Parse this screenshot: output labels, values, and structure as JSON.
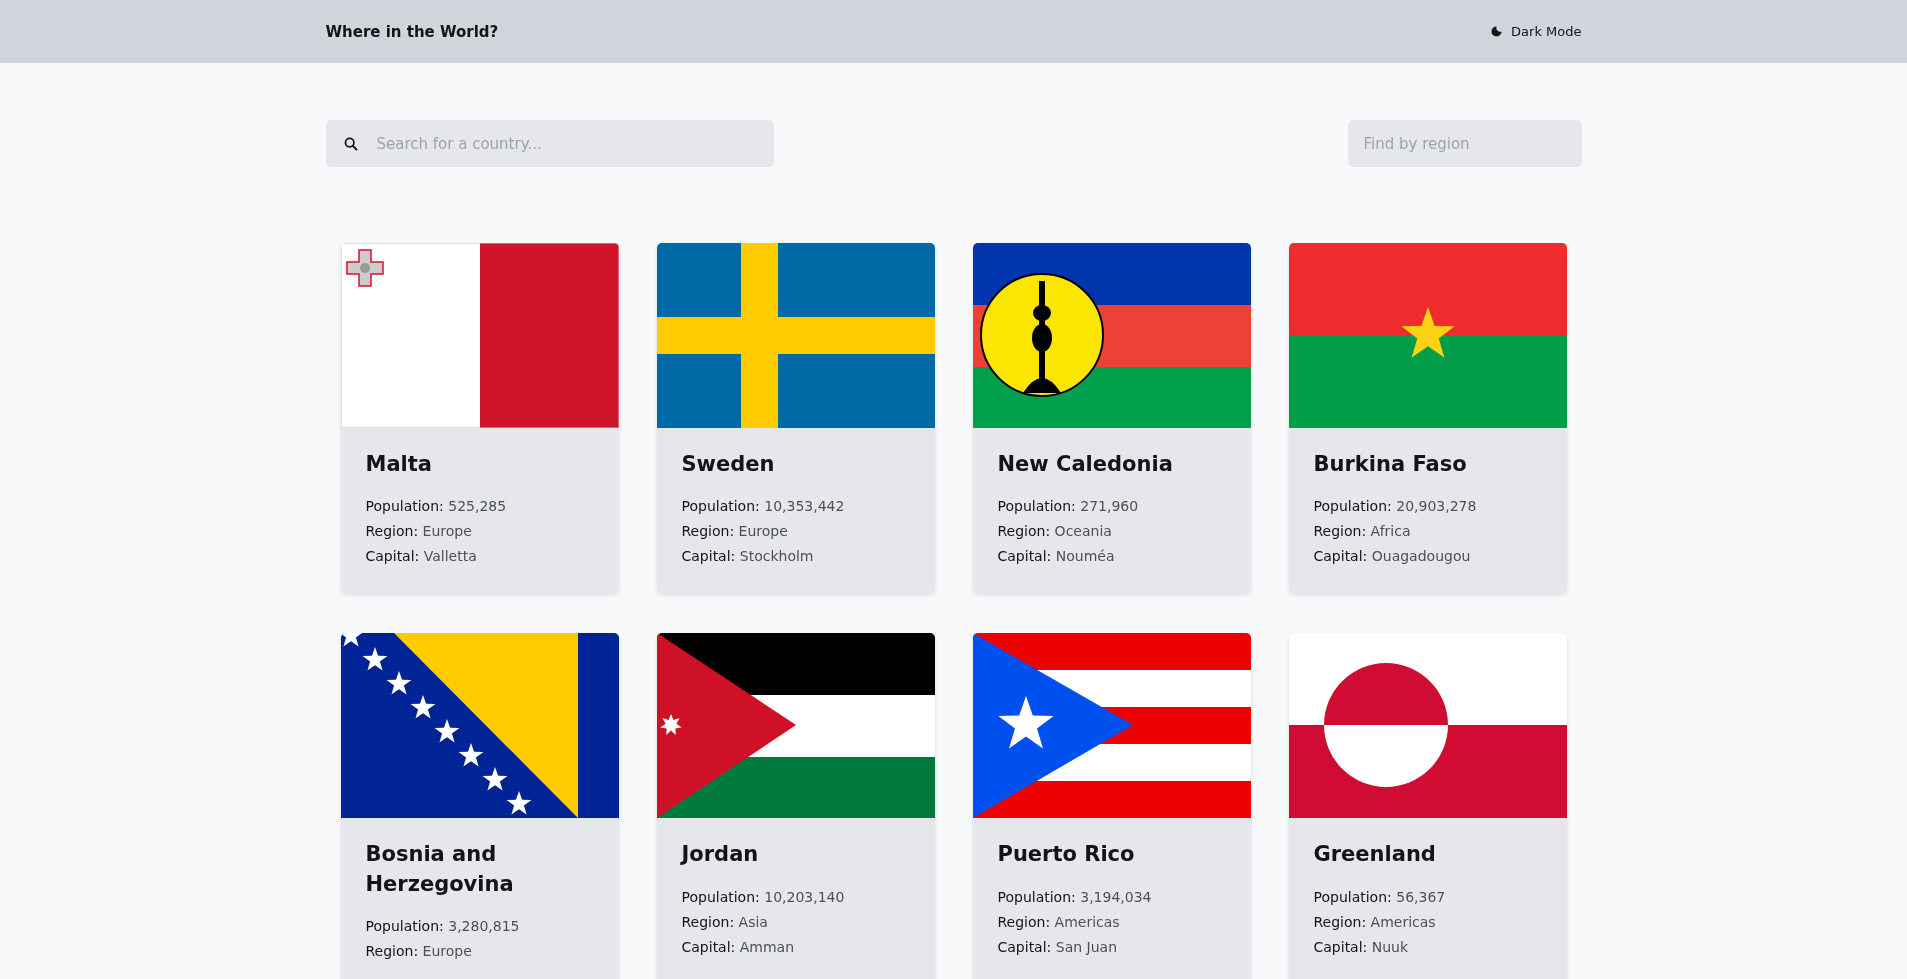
{
  "header": {
    "title": "Where in the World?",
    "theme_toggle": "Dark Mode"
  },
  "search": {
    "placeholder": "Search for a country..."
  },
  "region_filter": {
    "label": "Find by region"
  },
  "countries": [
    {
      "name": "Malta",
      "details": [
        {
          "label": "Population:",
          "value": "525,285"
        },
        {
          "label": "Region:",
          "value": "Europe"
        },
        {
          "label": "Capital:",
          "value": "Valletta"
        }
      ]
    },
    {
      "name": "Sweden",
      "details": [
        {
          "label": "Population:",
          "value": "10,353,442"
        },
        {
          "label": "Region:",
          "value": "Europe"
        },
        {
          "label": "Capital:",
          "value": "Stockholm"
        }
      ]
    },
    {
      "name": "New Caledonia",
      "details": [
        {
          "label": "Population:",
          "value": "271,960"
        },
        {
          "label": "Region:",
          "value": "Oceania"
        },
        {
          "label": "Capital:",
          "value": "Nouméa"
        }
      ]
    },
    {
      "name": "Burkina Faso",
      "details": [
        {
          "label": "Population:",
          "value": "20,903,278"
        },
        {
          "label": "Region:",
          "value": "Africa"
        },
        {
          "label": "Capital:",
          "value": "Ouagadougou"
        }
      ]
    },
    {
      "name": "Bosnia and Herzegovina",
      "details": [
        {
          "label": "Population:",
          "value": "3,280,815"
        },
        {
          "label": "Region:",
          "value": "Europe"
        }
      ]
    },
    {
      "name": "Jordan",
      "details": [
        {
          "label": "Population:",
          "value": "10,203,140"
        },
        {
          "label": "Region:",
          "value": "Asia"
        },
        {
          "label": "Capital:",
          "value": "Amman"
        }
      ]
    },
    {
      "name": "Puerto Rico",
      "details": [
        {
          "label": "Population:",
          "value": "3,194,034"
        },
        {
          "label": "Region:",
          "value": "Americas"
        },
        {
          "label": "Capital:",
          "value": "San Juan"
        }
      ]
    },
    {
      "name": "Greenland",
      "details": [
        {
          "label": "Population:",
          "value": "56,367"
        },
        {
          "label": "Region:",
          "value": "Americas"
        },
        {
          "label": "Capital:",
          "value": "Nuuk"
        }
      ]
    }
  ]
}
